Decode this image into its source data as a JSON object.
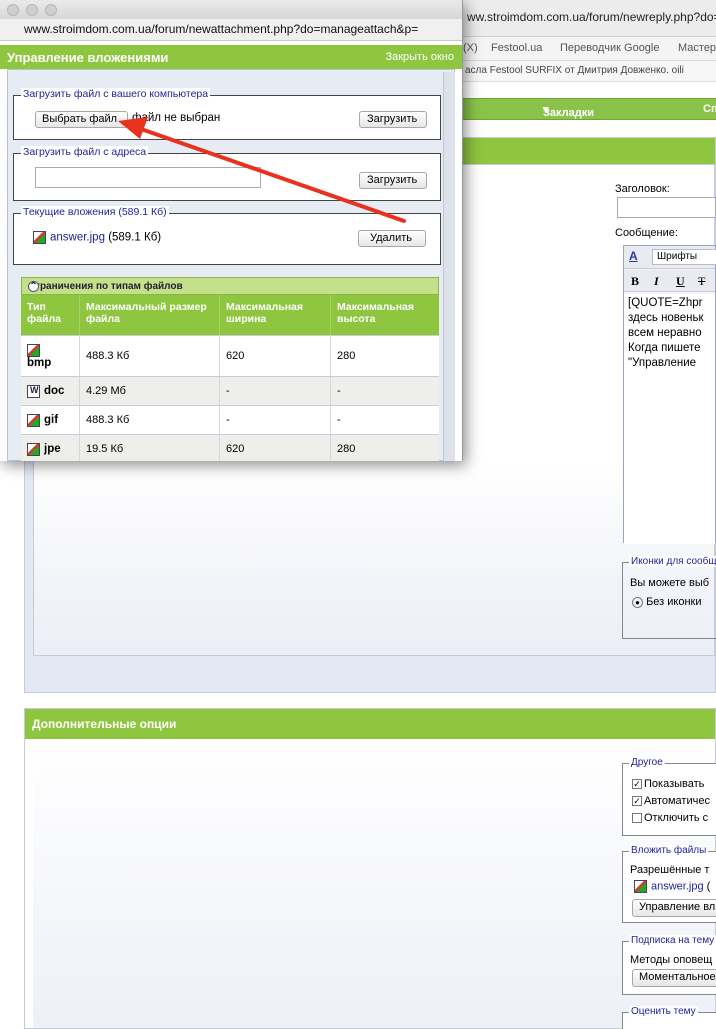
{
  "background": {
    "url_text": "ww.stroimdom.com.ua/forum/newreply.php?do=",
    "bookmarks": [
      "(X)",
      "Festool.ua",
      "Переводчик Google",
      "Мастер"
    ],
    "tab_title": "асла Festool SURFIX от Дмитрия Довженко. oili",
    "nav": [
      "Закладки",
      "Сп"
    ],
    "title_label": "Заголовок:",
    "message_label": "Сообщение:",
    "font_select": "Шрифты",
    "editor_buttons": [
      "B",
      "I",
      "U",
      "T"
    ],
    "editor_text": "[QUOTE=Zhpr\nздесь новеньк\nвсем неравно\nКогда пишете\n\"Управление",
    "icons_legend": "Иконки для сообщ",
    "icons_text": "Вы можете выб",
    "icons_option": "Без иконки",
    "options_title": "Дополнительные опции",
    "other_legend": "Другое",
    "other_checks": [
      {
        "label": "Показывать",
        "checked": true
      },
      {
        "label": "Автоматичес",
        "checked": true
      },
      {
        "label": "Отключить с",
        "checked": false
      }
    ],
    "attach_legend": "Вложить файлы",
    "attach_text": "Разрешённые т",
    "attach_file": "answer.jpg",
    "attach_paren": "(",
    "attach_button": "Управление вл",
    "subscribe_legend": "Подписка на тему",
    "subscribe_text": "Методы оповещ",
    "subscribe_select": "Моментальное",
    "rate_legend": "Оценить тему"
  },
  "popup": {
    "url_text": "www.stroimdom.com.ua/forum/newattachment.php?do=manageattach&p=",
    "title": "Управление вложениями",
    "close_link": "Закрыть окно",
    "upload_computer": {
      "legend": "Загрузить файл с вашего компьютера",
      "choose_button": "Выбрать файл",
      "no_file": "файл не выбран",
      "upload_button": "Загрузить"
    },
    "upload_url": {
      "legend": "Загрузить файл с адреса",
      "value": "",
      "upload_button": "Загрузить"
    },
    "current": {
      "legend": "Текущие вложения (589.1 Кб)",
      "file_name": "answer.jpg",
      "file_size": "(589.1 Кб)",
      "delete_button": "Удалить"
    },
    "limits": {
      "title": "Ограничения по типам файлов",
      "columns": [
        "Тип файла",
        "Максимальный размер файла",
        "Максимальная ширина",
        "Максимальная высота"
      ],
      "rows": [
        {
          "type": "bmp",
          "icon": "image-file-icon",
          "size": "488.3 Кб",
          "width": "620",
          "height": "280"
        },
        {
          "type": "doc",
          "icon": "word-file-icon",
          "size": "4.29 Мб",
          "width": "-",
          "height": "-"
        },
        {
          "type": "gif",
          "icon": "image-file-icon",
          "size": "488.3 Кб",
          "width": "-",
          "height": "-"
        },
        {
          "type": "jpe",
          "icon": "image-file-icon",
          "size": "19.5 Кб",
          "width": "620",
          "height": "280"
        }
      ]
    }
  },
  "annotation": {
    "arrow_color": "#e8311f"
  },
  "colors": {
    "accent_green": "#8fc63f",
    "link_blue": "#22229c"
  }
}
